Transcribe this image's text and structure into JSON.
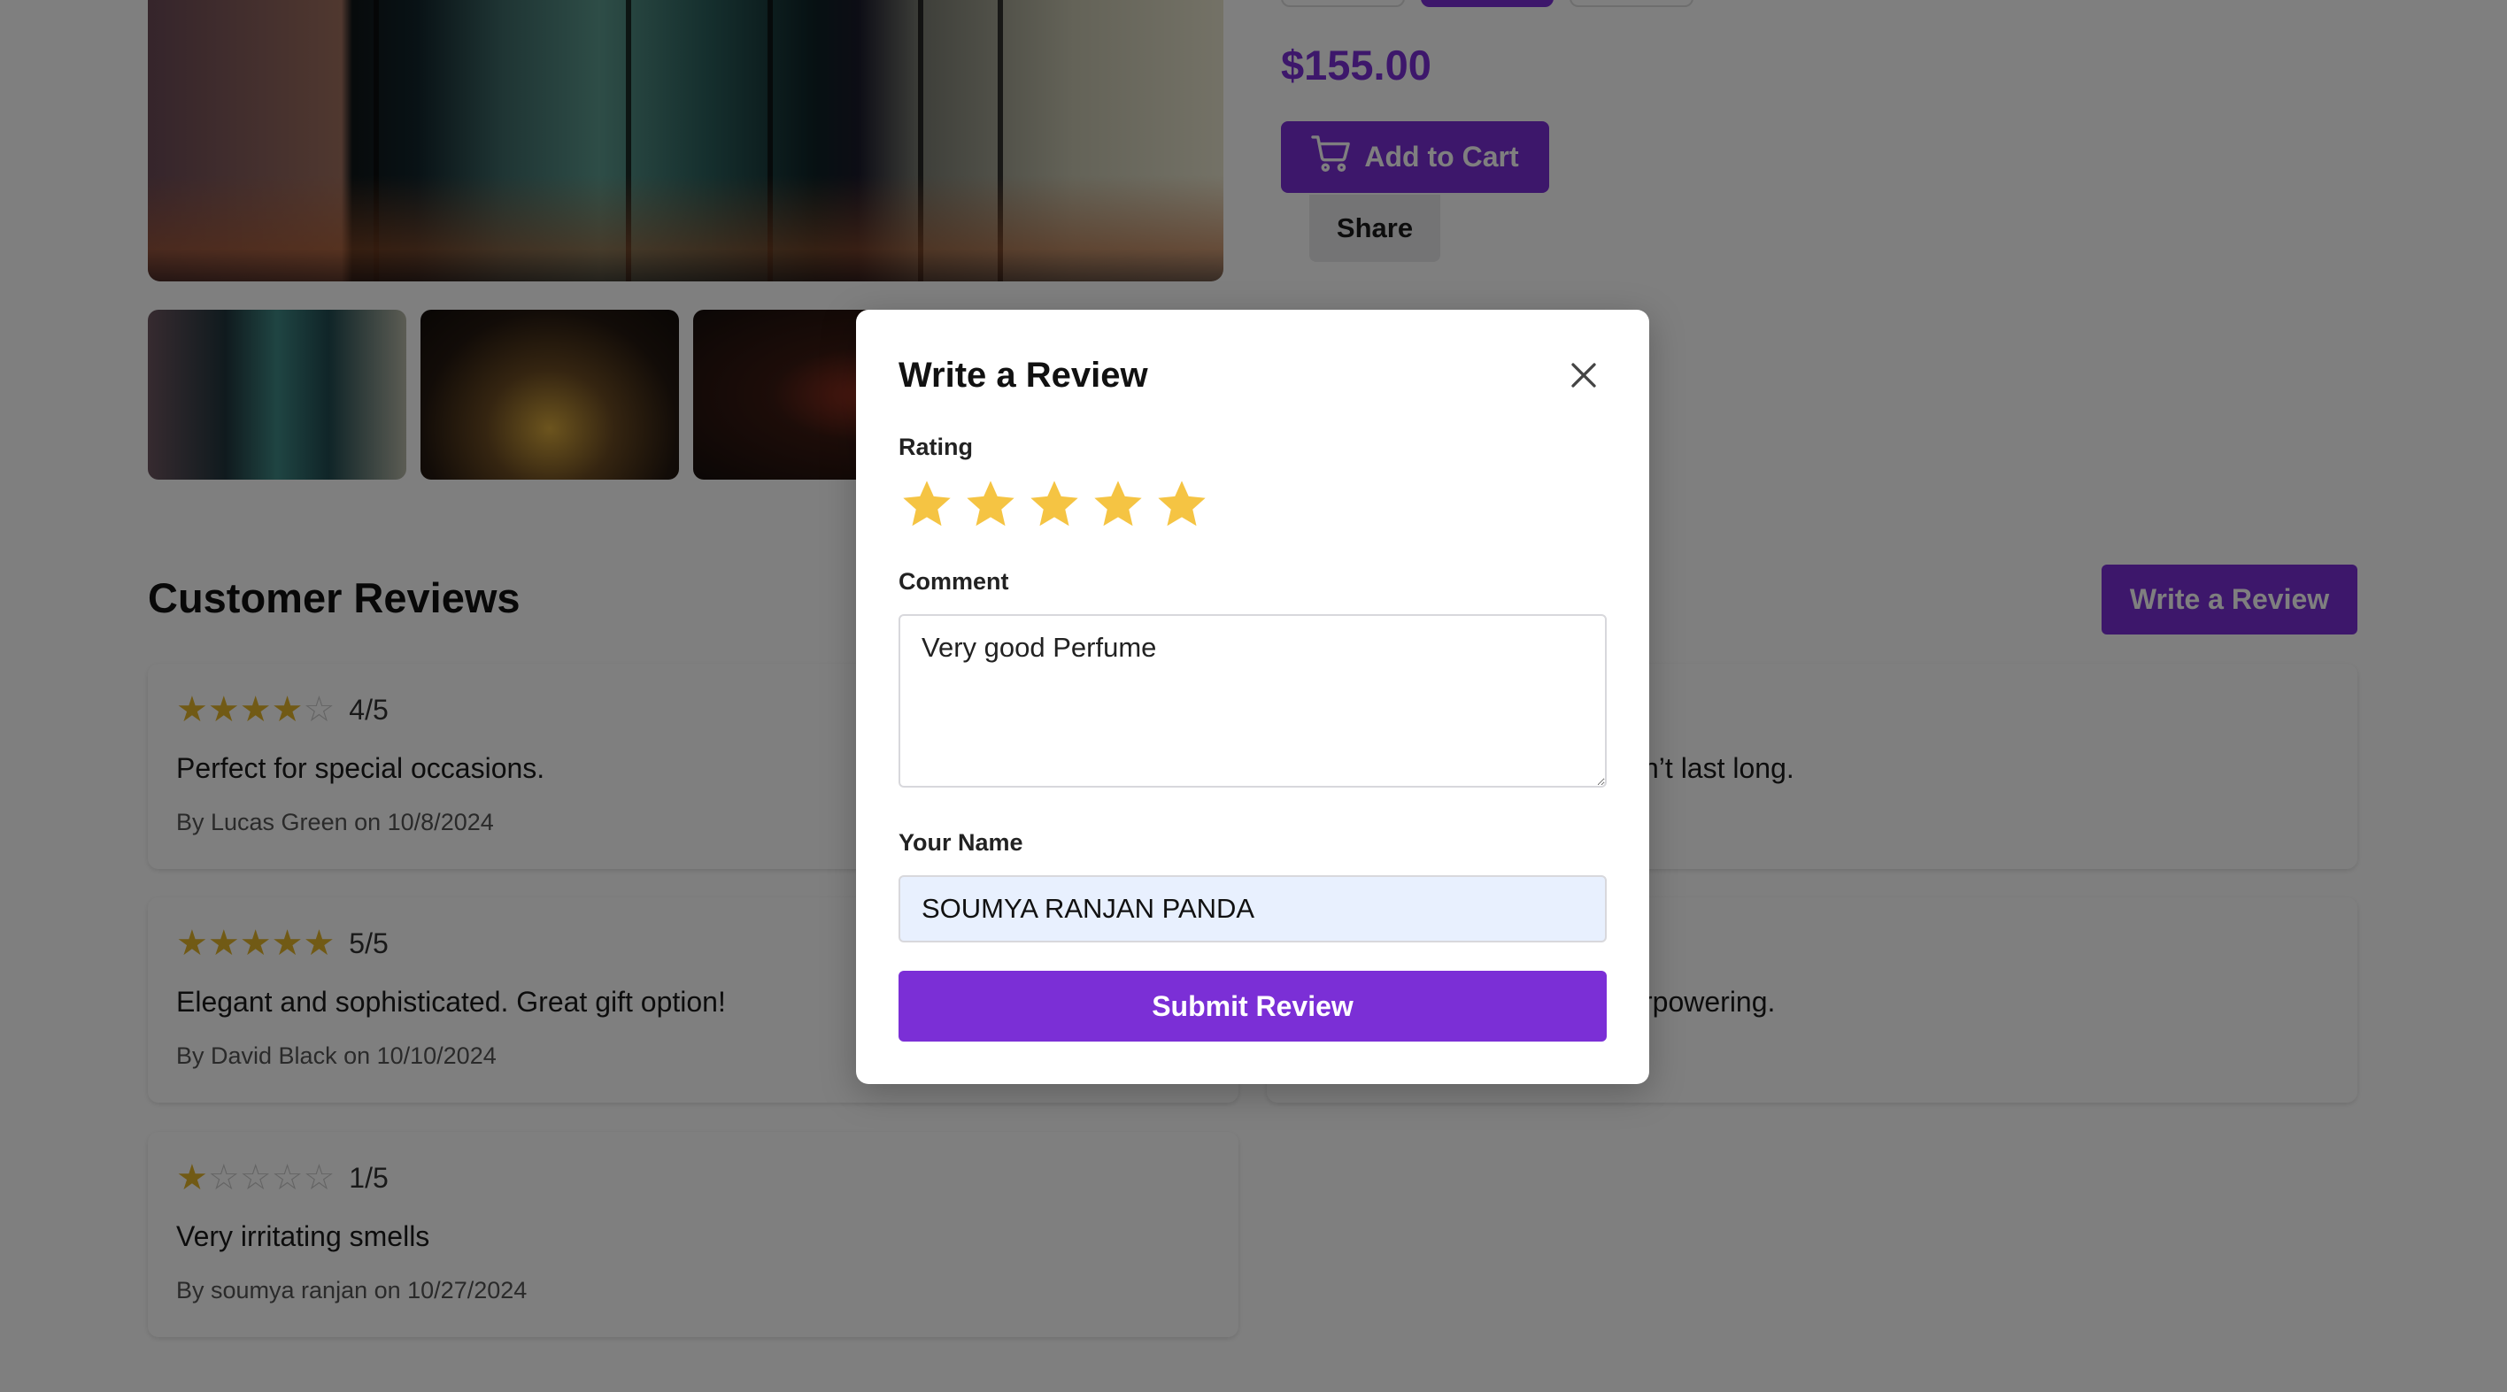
{
  "product": {
    "price": "$155.00",
    "add_to_cart_label": "Add to Cart",
    "share_label": "Share"
  },
  "reviews": {
    "title": "Customer Reviews",
    "write_review_label": "Write a Review",
    "items": [
      {
        "rating": 4,
        "score_text": "4/5",
        "comment": "Perfect for special occasions.",
        "byline": "By Lucas Green on 10/8/2024"
      },
      {
        "rating": 5,
        "score_text": "5/5",
        "comment": "Elegant and sophisticated. Great gift option!",
        "byline": "By David Black on 10/10/2024"
      },
      {
        "rating": 1,
        "score_text": "1/5",
        "comment": "Very irritating smells",
        "byline": "By soumya ranjan on 10/27/2024"
      },
      {
        "rating": null,
        "score_text": "",
        "comment": "n’t last long.",
        "byline": ""
      },
      {
        "rating": null,
        "score_text": "",
        "comment": "rpowering.",
        "byline": ""
      }
    ]
  },
  "modal": {
    "title": "Write a Review",
    "rating_label": "Rating",
    "rating_value": 5,
    "comment_label": "Comment",
    "comment_value": "Very good Perfume",
    "name_label": "Your Name",
    "name_value": "SOUMYA RANJAN PANDA",
    "submit_label": "Submit Review"
  },
  "colors": {
    "accent": "#7b2fd6",
    "star": "#f5c443",
    "star_small": "#e3b42a",
    "overlay": "rgba(0,0,0,0.5)"
  },
  "icons": {
    "cart": "cart-icon",
    "close": "close-icon",
    "star": "star-icon"
  }
}
